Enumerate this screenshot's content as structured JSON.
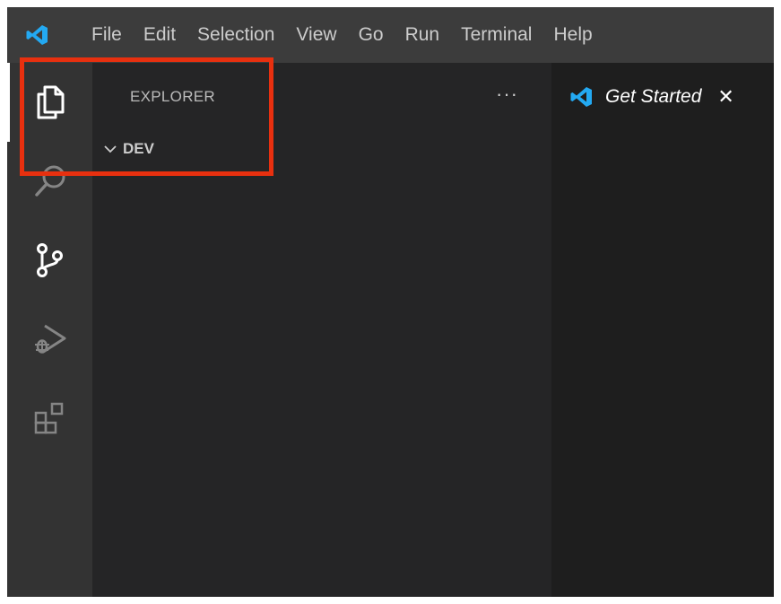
{
  "app": {
    "logo_icon": "vscode-logo-icon",
    "logo_color": "#23a9f2"
  },
  "menu": [
    "File",
    "Edit",
    "Selection",
    "View",
    "Go",
    "Run",
    "Terminal",
    "Help"
  ],
  "activity_bar": {
    "items": [
      {
        "name": "explorer",
        "icon": "files-icon",
        "active": true
      },
      {
        "name": "search",
        "icon": "search-icon",
        "active": false
      },
      {
        "name": "source-control",
        "icon": "source-control-icon",
        "active": false
      },
      {
        "name": "run-debug",
        "icon": "run-debug-icon",
        "active": false
      },
      {
        "name": "extensions",
        "icon": "extensions-icon",
        "active": false
      }
    ]
  },
  "sidebar": {
    "title": "EXPLORER",
    "more_label": "···",
    "folder": {
      "name": "DEV",
      "expanded": true
    }
  },
  "editor": {
    "tabs": [
      {
        "label": "Get Started",
        "close_label": "✕",
        "icon": "vscode-logo-icon"
      }
    ]
  },
  "colors": {
    "titlebar": "#3c3c3c",
    "activity_bar": "#333333",
    "sidebar": "#252526",
    "editor": "#1e1e1e",
    "highlight": "#e8300f"
  }
}
